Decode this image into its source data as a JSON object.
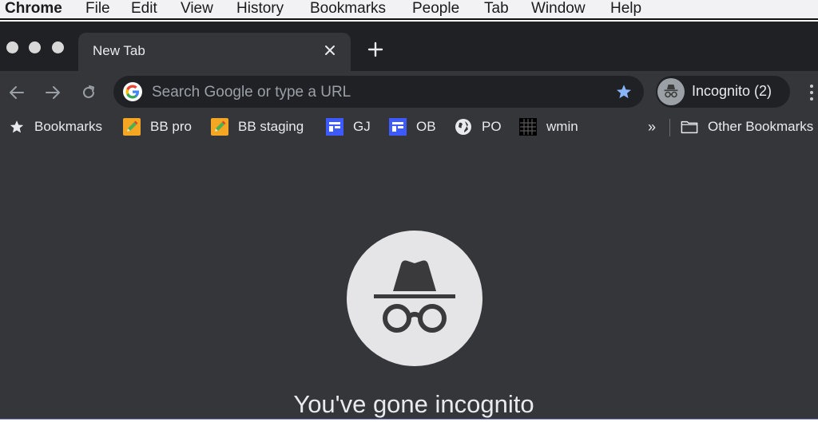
{
  "menubar": {
    "items": [
      "Chrome",
      "File",
      "Edit",
      "View",
      "History",
      "Bookmarks",
      "People",
      "Tab",
      "Window",
      "Help"
    ]
  },
  "tab": {
    "title": "New Tab"
  },
  "toolbar": {
    "omnibox_placeholder": "Search Google or type a URL",
    "profile_label": "Incognito (2)"
  },
  "bookmarks": {
    "items": [
      {
        "label": "Bookmarks",
        "icon": "star-icon"
      },
      {
        "label": "BB pro",
        "icon": "pencil-icon"
      },
      {
        "label": "BB staging",
        "icon": "pencil-icon"
      },
      {
        "label": "GJ",
        "icon": "layout-icon"
      },
      {
        "label": "OB",
        "icon": "layout-icon"
      },
      {
        "label": "PO",
        "icon": "globe-icon"
      },
      {
        "label": "wmin",
        "icon": "grid-icon"
      }
    ],
    "overflow_label": "»",
    "other_label": "Other Bookmarks"
  },
  "content": {
    "headline": "You've gone incognito"
  },
  "colors": {
    "frame": "#202124",
    "toolbar": "#35363a",
    "text": "#e8eaed",
    "star_accent": "#8ab4f8",
    "bookmark_blue": "#3d5afe",
    "bookmark_orange": "#f5a623"
  }
}
